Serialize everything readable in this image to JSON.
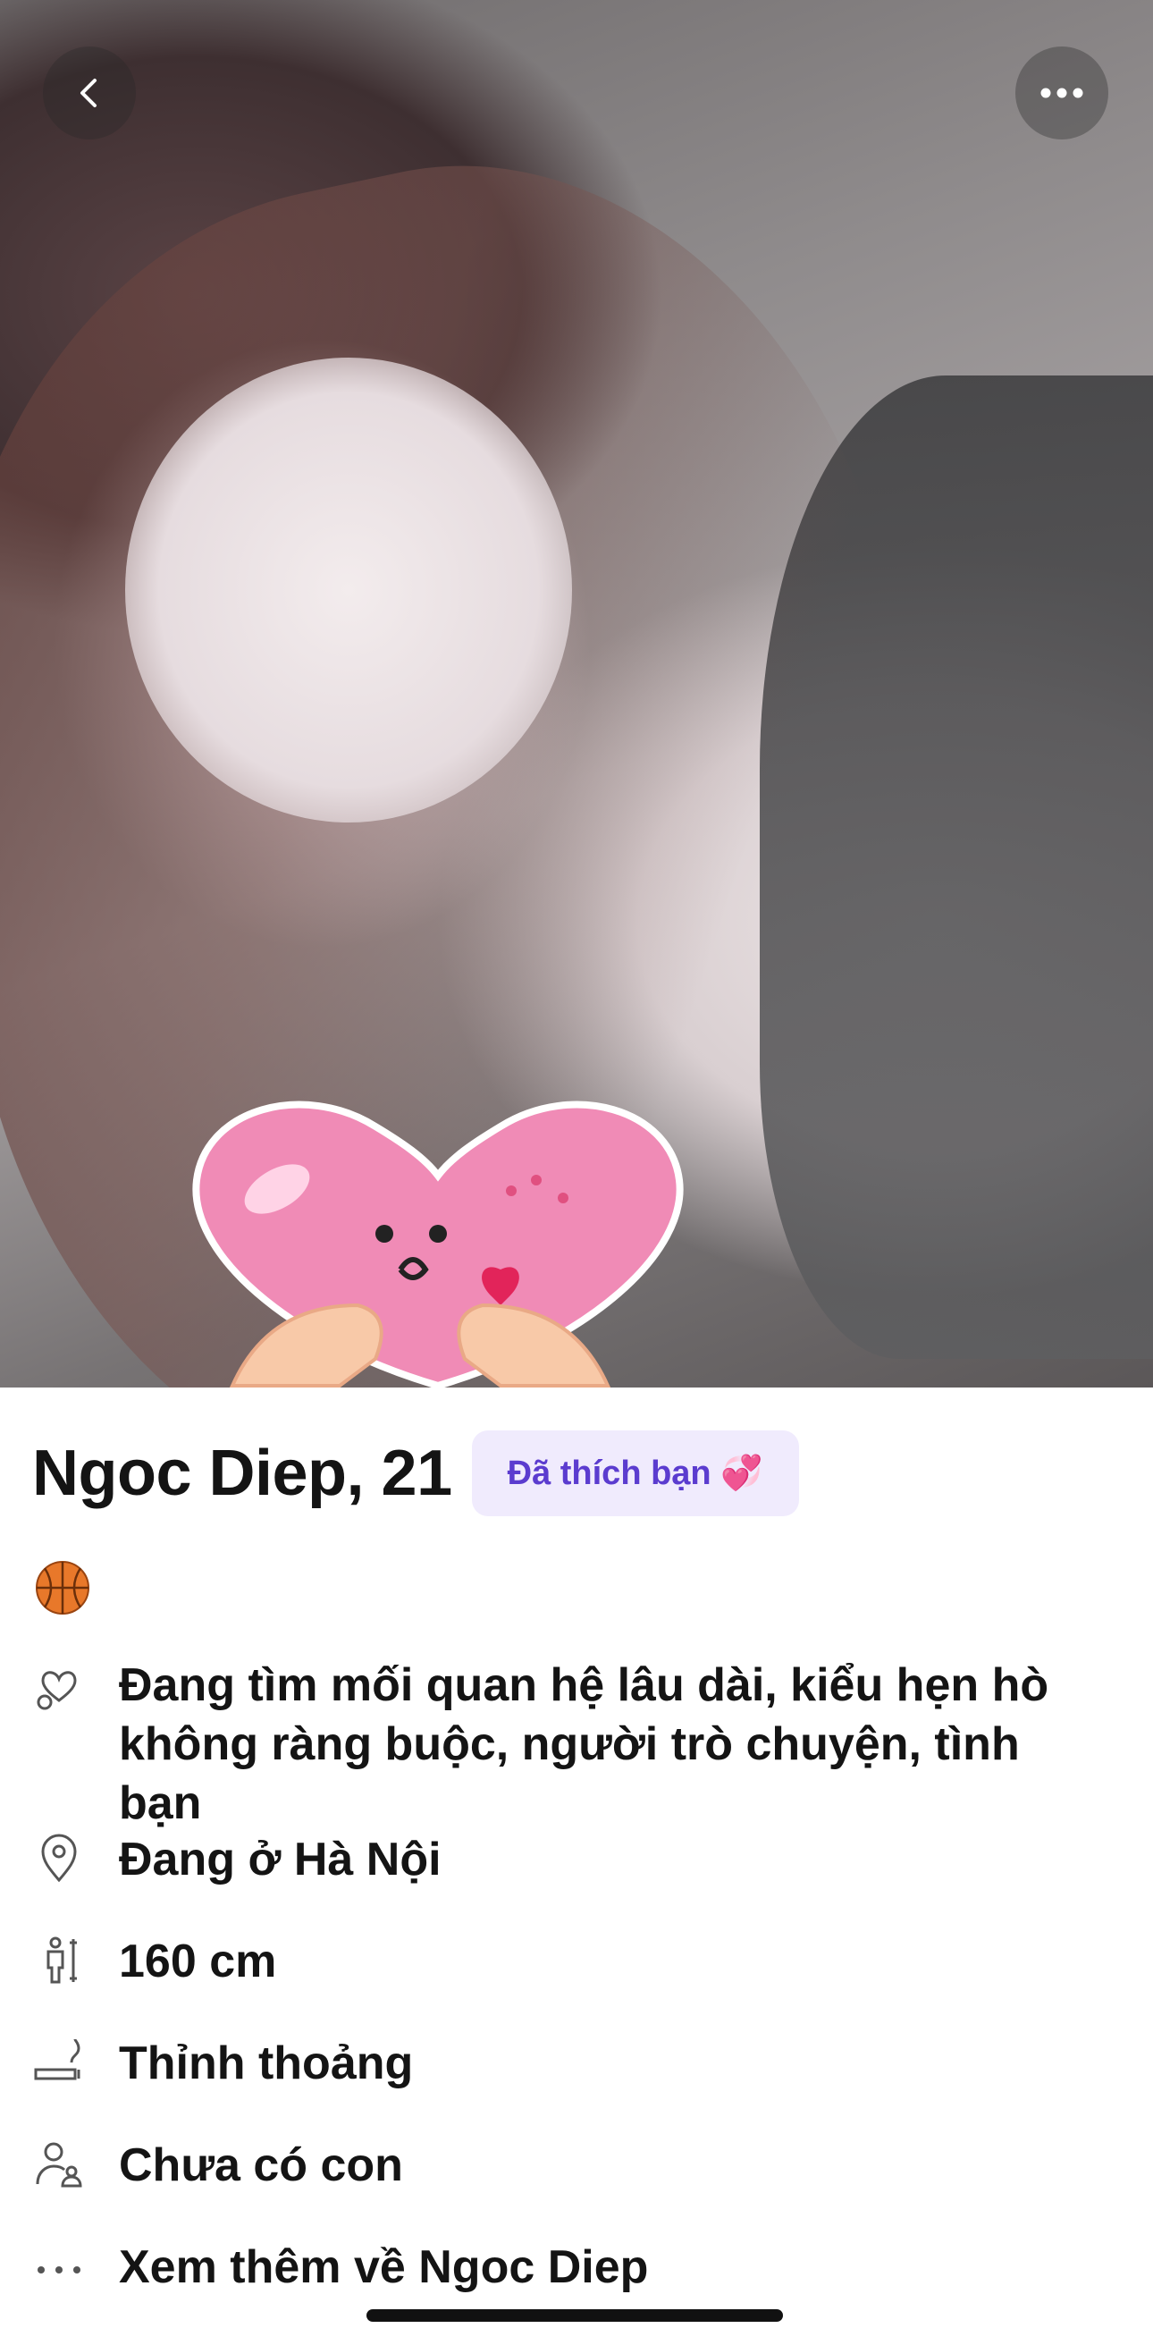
{
  "profile": {
    "name_age": "Ngoc Diep, 21",
    "badge": "Đã thích bạn 💞",
    "interest_emoji": "🏀"
  },
  "details": [
    {
      "icon": "heart-search-icon",
      "text": "Đang tìm mối quan hệ lâu dài, kiểu hẹn hò không ràng buộc, người trò chuyện, tình bạn"
    },
    {
      "icon": "location-pin-icon",
      "text": "Đang ở Hà Nội"
    },
    {
      "icon": "height-icon",
      "text": "160 cm"
    },
    {
      "icon": "smoking-icon",
      "text": "Thỉnh thoảng"
    },
    {
      "icon": "children-icon",
      "text": "Chưa có con"
    },
    {
      "icon": "more-dots-icon",
      "text": "Xem thêm về Ngoc Diep"
    }
  ],
  "colors": {
    "badge_bg": "#f0ebfd",
    "badge_text": "#5b3ccf",
    "text": "#141414"
  }
}
